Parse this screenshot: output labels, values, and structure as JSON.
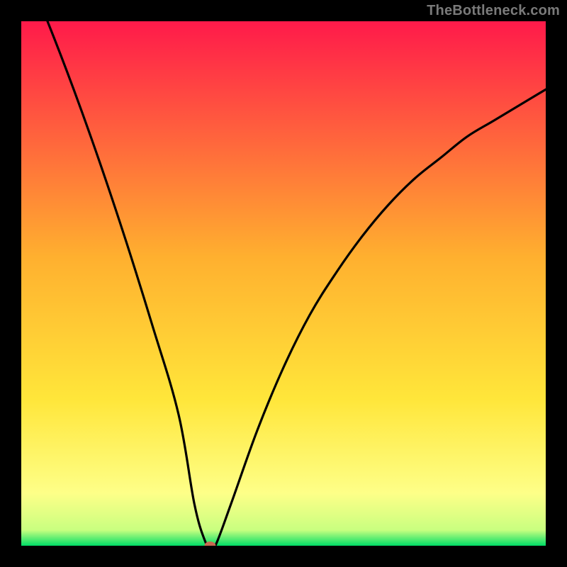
{
  "watermark": "TheBottleneck.com",
  "colors": {
    "frame": "#000000",
    "gradient_top": "#ff1a4a",
    "gradient_mid": "#ffcf2f",
    "gradient_low": "#feff88",
    "gradient_bottom": "#00dd66",
    "curve": "#000000",
    "marker": "#c76a52"
  },
  "chart_data": {
    "type": "line",
    "title": "",
    "xlabel": "",
    "ylabel": "",
    "xlim": [
      0,
      100
    ],
    "ylim": [
      0,
      100
    ],
    "grid": false,
    "legend": false,
    "gradient_meaning": "severity (red=high, green=low)",
    "series": [
      {
        "name": "bottleneck-curve",
        "x": [
          0,
          5,
          10,
          15,
          20,
          25,
          30,
          33,
          35,
          36,
          37,
          40,
          45,
          50,
          55,
          60,
          65,
          70,
          75,
          80,
          85,
          90,
          95,
          100
        ],
        "values": [
          112,
          100,
          87,
          73,
          58,
          42,
          25,
          8,
          1,
          0,
          0,
          8,
          22,
          34,
          44,
          52,
          59,
          65,
          70,
          74,
          78,
          81,
          84,
          87
        ]
      }
    ],
    "annotations": [
      {
        "name": "optimal-point",
        "x": 36,
        "y": 0
      }
    ]
  }
}
